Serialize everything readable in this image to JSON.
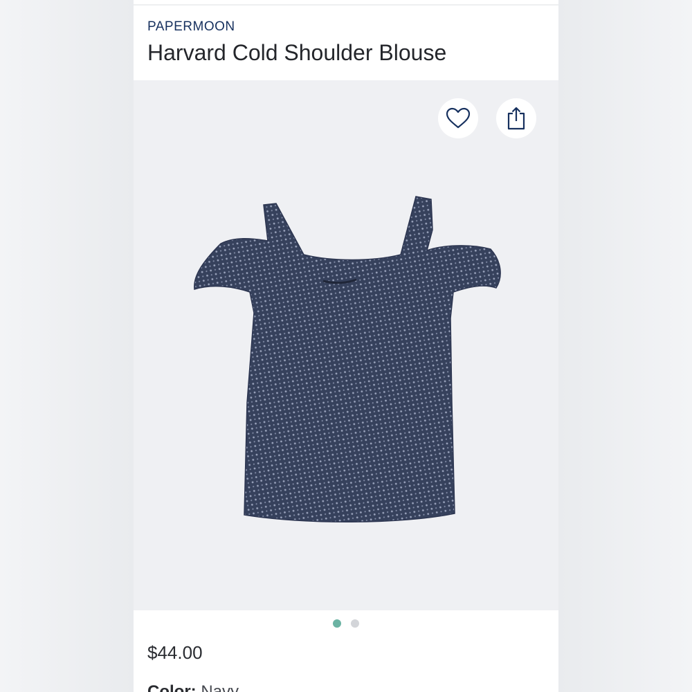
{
  "product": {
    "brand": "PAPERMOON",
    "title": "Harvard Cold Shoulder Blouse",
    "price": "$44.00",
    "color_label": "Color:",
    "color_value": "Navy"
  },
  "carousel": {
    "total_images": 2,
    "active_index": 0
  },
  "icons": {
    "favorite": "heart-icon",
    "share": "share-icon"
  },
  "colors": {
    "brand": "#16305e",
    "active_dot": "#6bb3a3",
    "inactive_dot": "#d3d5d9",
    "garment": "#3a4560"
  }
}
